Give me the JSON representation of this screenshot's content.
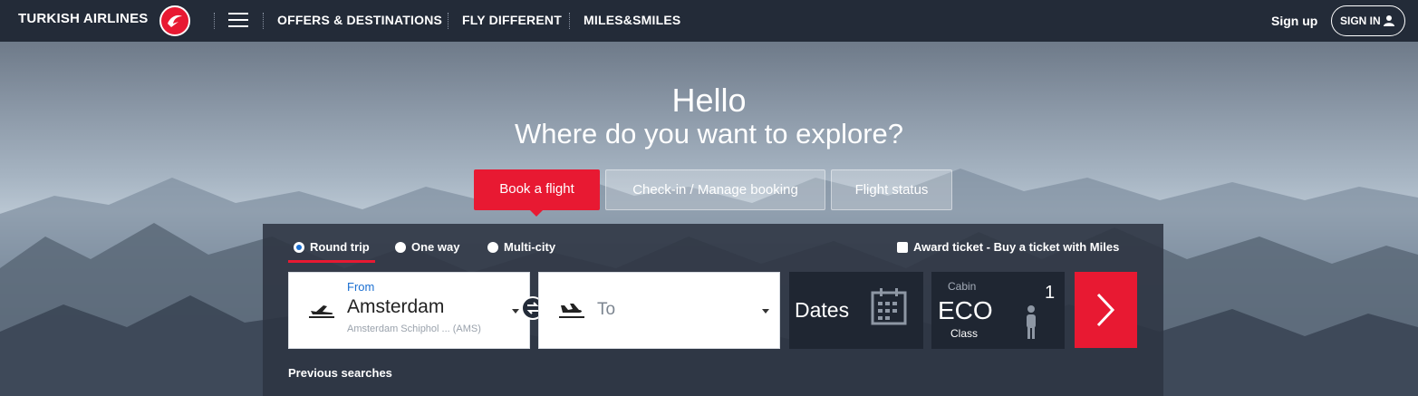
{
  "header": {
    "brand": "TURKISH AIRLINES",
    "nav": [
      "OFFERS & DESTINATIONS",
      "FLY DIFFERENT",
      "MILES&SMILES"
    ],
    "sign_up": "Sign up",
    "sign_in": "SIGN IN"
  },
  "hero": {
    "greeting": "Hello",
    "subtitle": "Where do you want to explore?"
  },
  "tabs": [
    "Book a flight",
    "Check-in / Manage booking",
    "Flight status"
  ],
  "booking": {
    "trip_types": [
      "Round trip",
      "One way",
      "Multi-city"
    ],
    "selected_trip": "Round trip",
    "award": "Award ticket - Buy a ticket with Miles",
    "from_label": "From",
    "from_city": "Amsterdam",
    "from_airport": "Amsterdam Schiphol ... (AMS)",
    "to_placeholder": "To",
    "dates": "Dates",
    "cabin_label": "Cabin",
    "cabin_value": "ECO",
    "cabin_class": "Class",
    "passengers": "1",
    "previous": "Previous searches"
  },
  "colors": {
    "brand_red": "#e81932",
    "nav_bg": "#232b38",
    "link_blue": "#1b6fd1"
  }
}
